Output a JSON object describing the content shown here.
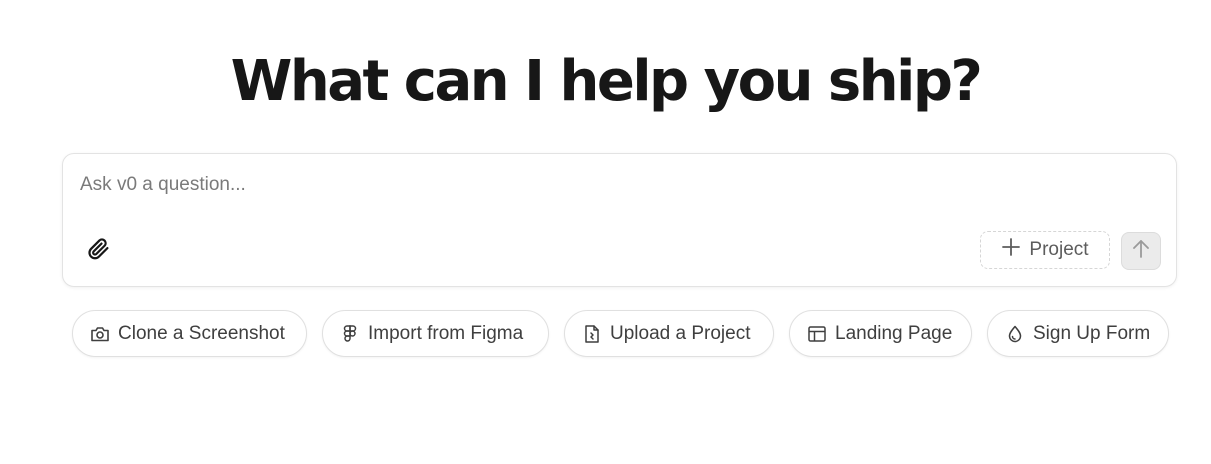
{
  "hero": {
    "title": "What can I help you ship?"
  },
  "composer": {
    "placeholder": "Ask v0 a question...",
    "value": "",
    "attach_icon": "paperclip-icon",
    "project_label": "Project",
    "project_icon": "plus-icon",
    "send_icon": "arrow-up-icon"
  },
  "suggestions": [
    {
      "label": "Clone a Screenshot",
      "icon": "camera-icon"
    },
    {
      "label": "Import from Figma",
      "icon": "figma-icon"
    },
    {
      "label": "Upload a Project",
      "icon": "file-upload-icon"
    },
    {
      "label": "Landing Page",
      "icon": "layout-icon"
    },
    {
      "label": "Sign Up Form",
      "icon": "droplet-icon"
    }
  ],
  "colors": {
    "text": "#171717",
    "muted": "#5c5c5c",
    "border": "#e3e3e3",
    "send_bg": "#ebebeb"
  }
}
